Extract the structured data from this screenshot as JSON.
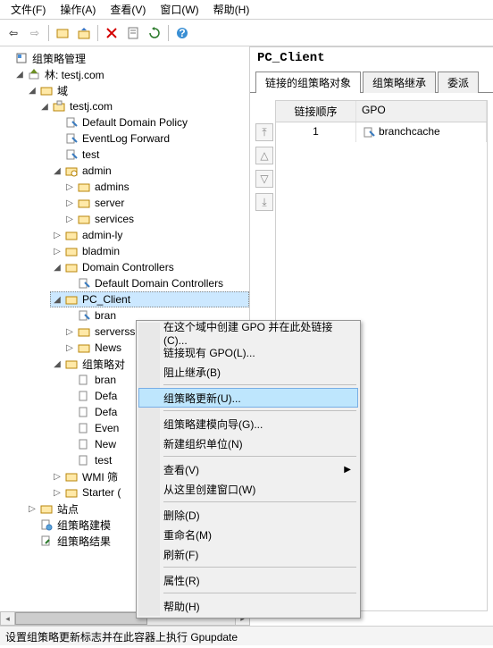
{
  "menubar": {
    "file": "文件(F)",
    "action": "操作(A)",
    "view": "查看(V)",
    "window": "窗口(W)",
    "help": "帮助(H)"
  },
  "tree": {
    "root_title": "组策略管理",
    "forest": "林: testj.com",
    "domains": "域",
    "domain": "testj.com",
    "items": {
      "default_domain_policy": "Default Domain Policy",
      "eventlog_forward": "EventLog Forward",
      "test": "test",
      "admin": "admin",
      "admins": "admins",
      "server": "server",
      "services": "services",
      "admin_ly": "admin-ly",
      "bladmin": "bladmin",
      "domain_controllers": "Domain Controllers",
      "default_dc": "Default Domain Controllers",
      "pc_client": "PC_Client",
      "bran": "bran",
      "serverss": "serverss",
      "news": "News",
      "gpo_obj": "组策略对",
      "bran2": "bran",
      "defa": "Defa",
      "defa2": "Defa",
      "even": "Even",
      "new2": "New",
      "test2": "test",
      "wmi": "WMI 筛",
      "starter": "Starter (",
      "sites": "站点",
      "gp_modeling": "组策略建模",
      "gp_results": "组策略结果"
    }
  },
  "right": {
    "title": "PC_Client",
    "tabs": {
      "linked": "链接的组策略对象",
      "inheritance": "组策略继承",
      "delegation": "委派"
    },
    "grid": {
      "col_order": "链接顺序",
      "col_gpo": "GPO",
      "row1_order": "1",
      "row1_gpo": "branchcache"
    }
  },
  "context_menu": {
    "create_gpo": "在这个域中创建 GPO 并在此处链接(C)...",
    "link_existing": "链接现有 GPO(L)...",
    "block_inherit": "阻止继承(B)",
    "gp_update": "组策略更新(U)...",
    "gp_modeling_wizard": "组策略建模向导(G)...",
    "new_ou": "新建组织单位(N)",
    "view": "查看(V)",
    "new_window": "从这里创建窗口(W)",
    "delete": "删除(D)",
    "rename": "重命名(M)",
    "refresh": "刷新(F)",
    "properties": "属性(R)",
    "help": "帮助(H)"
  },
  "statusbar": "设置组策略更新标志并在此容器上执行 Gpupdate"
}
